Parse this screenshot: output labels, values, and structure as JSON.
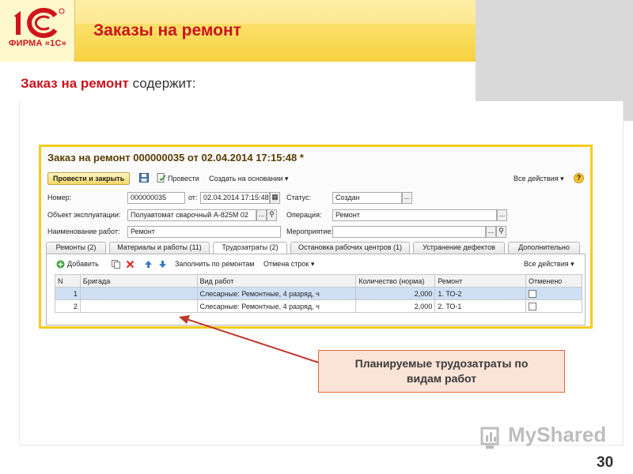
{
  "slide": {
    "logo_text": "ФИРМА «1С»",
    "title": "Заказы на ремонт",
    "subtitle_bold": "Заказ на ремонт",
    "subtitle_rest": " содержит:",
    "page_number": "30"
  },
  "form": {
    "title": "Заказ на ремонт 000000035 от 02.04.2014 17:15:48 *",
    "toolbar": {
      "post_close": "Провести и закрыть",
      "post": "Провести",
      "create_based": "Создать на основании",
      "all_actions": "Все действия",
      "help": "?"
    },
    "fields": {
      "number_label": "Номер:",
      "number_value": "000000035",
      "from_label": "от:",
      "date_value": "02.04.2014 17:15:48",
      "status_label": "Статус:",
      "status_value": "Создан",
      "object_label": "Объект эксплуатации:",
      "object_value": "Полуавтомат сварочный А-825М  02",
      "operation_label": "Операция:",
      "operation_value": "Ремонт",
      "work_name_label": "Наименование работ:",
      "work_name_value": "Ремонт",
      "event_label": "Мероприятие:",
      "event_value": ""
    },
    "tabs": [
      "Ремонты (2)",
      "Материалы и работы (11)",
      "Трудозатраты (2)",
      "Остановка рабочих центров (1)",
      "Устранение дефектов",
      "Дополнительно"
    ],
    "grid_toolbar": {
      "add": "Добавить",
      "fill": "Заполнить по ремонтам",
      "cancel_rows": "Отмена строк",
      "all_actions": "Все действия"
    },
    "columns": [
      "N",
      "Бригада",
      "Вид работ",
      "Количество (норма)",
      "Ремонт",
      "Отменено"
    ],
    "rows": [
      [
        "1",
        "",
        "Слесарные: Ремонтные, 4 разряд, ч",
        "2,000",
        "1. ТО-2"
      ],
      [
        "2",
        "",
        "Слесарные: Ремонтные, 4 разряд, ч",
        "2,000",
        "2. ТО-1"
      ]
    ]
  },
  "callout": {
    "line1": "Планируемые трудозатраты по",
    "line2": "видам работ"
  },
  "watermark": "MyShared",
  "colors": {
    "brand_red": "#c9141e",
    "header_yellow": "#f7d23e",
    "form_border": "#f5cc1a",
    "callout_fill": "#fbe3d6",
    "callout_border": "#e06a3c",
    "arrow": "#c0392b"
  }
}
